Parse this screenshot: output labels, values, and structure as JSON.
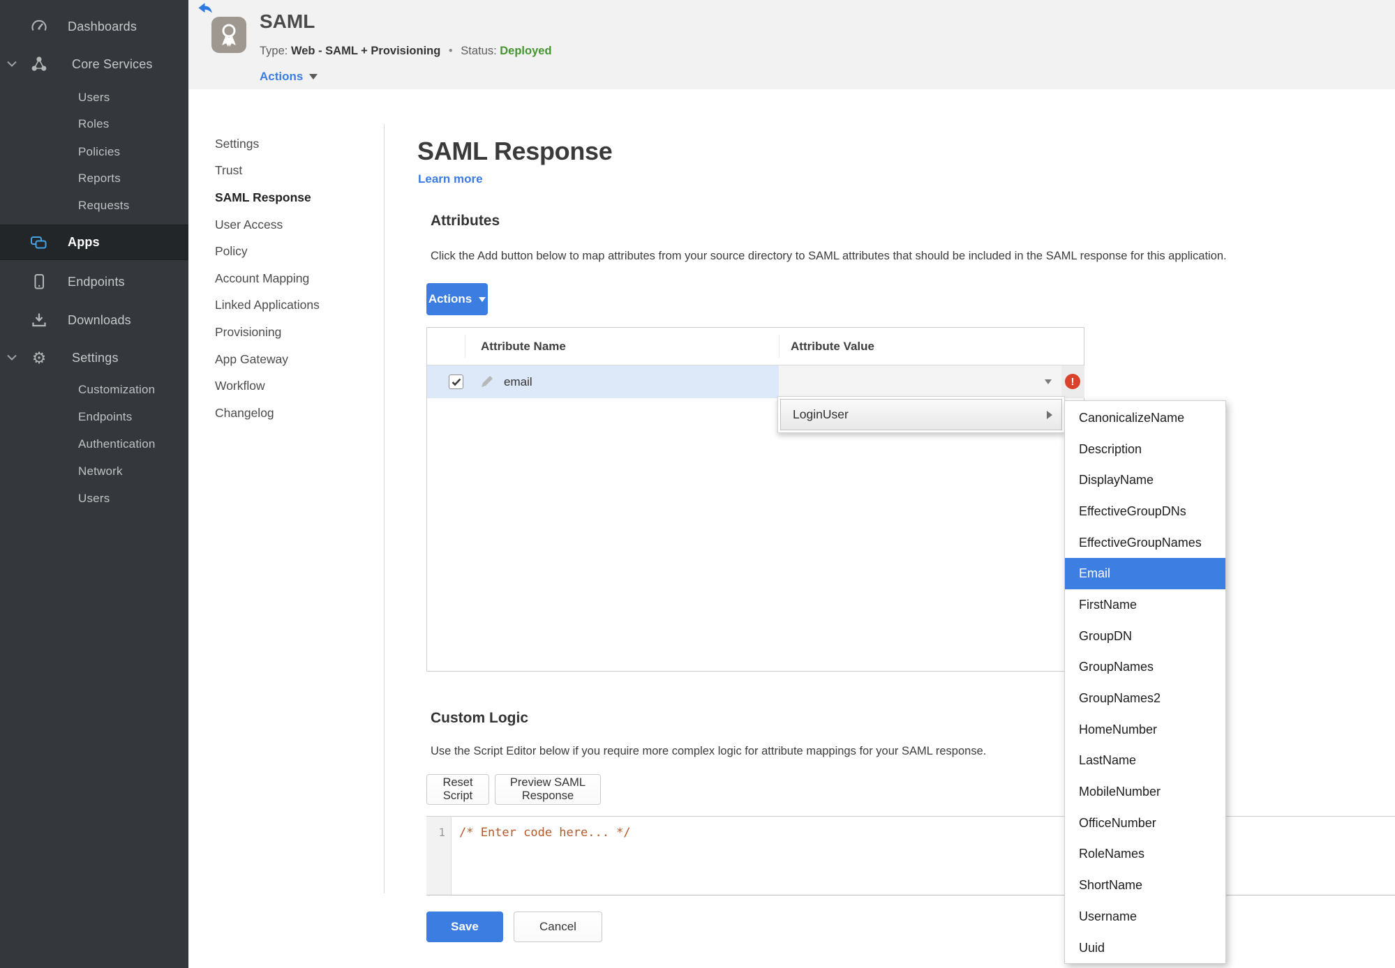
{
  "sidebar": {
    "items": [
      {
        "label": "Dashboards"
      },
      {
        "label": "Core Services"
      },
      {
        "label": "Users"
      },
      {
        "label": "Roles"
      },
      {
        "label": "Policies"
      },
      {
        "label": "Reports"
      },
      {
        "label": "Requests"
      },
      {
        "label": "Apps",
        "active": true
      },
      {
        "label": "Endpoints"
      },
      {
        "label": "Downloads"
      },
      {
        "label": "Settings"
      },
      {
        "label": "Customization"
      },
      {
        "label": "Endpoints"
      },
      {
        "label": "Authentication"
      },
      {
        "label": "Network"
      },
      {
        "label": "Users"
      }
    ]
  },
  "header": {
    "title": "SAML",
    "type_label": "Type:",
    "type_value": "Web - SAML + Provisioning",
    "separator": "•",
    "status_label": "Status:",
    "status_value": "Deployed",
    "actions_label": "Actions"
  },
  "subnav": {
    "items": [
      {
        "label": "Settings"
      },
      {
        "label": "Trust"
      },
      {
        "label": "SAML Response",
        "active": true
      },
      {
        "label": "User Access"
      },
      {
        "label": "Policy"
      },
      {
        "label": "Account Mapping"
      },
      {
        "label": "Linked Applications"
      },
      {
        "label": "Provisioning"
      },
      {
        "label": "App Gateway"
      },
      {
        "label": "Workflow"
      },
      {
        "label": "Changelog"
      }
    ]
  },
  "page": {
    "title": "SAML Response",
    "learn_more": "Learn more"
  },
  "attributes": {
    "heading": "Attributes",
    "description": "Click the Add button below to map attributes from your source directory to SAML attributes that should be included in the SAML response for this application.",
    "actions_label": "Actions",
    "columns": [
      "Attribute Name",
      "Attribute Value"
    ],
    "row": {
      "name": "email",
      "checked": true,
      "error": true
    }
  },
  "value_menu": {
    "parent_label": "LoginUser",
    "options": [
      "CanonicalizeName",
      "Description",
      "DisplayName",
      "EffectiveGroupDNs",
      "EffectiveGroupNames",
      "Email",
      "FirstName",
      "GroupDN",
      "GroupNames",
      "GroupNames2",
      "HomeNumber",
      "LastName",
      "MobileNumber",
      "OfficeNumber",
      "RoleNames",
      "ShortName",
      "Username",
      "Uuid"
    ],
    "selected": "Email"
  },
  "custom_logic": {
    "heading": "Custom Logic",
    "description": "Use the Script Editor below if you require more complex logic for attribute mappings for your SAML response.",
    "reset_label": "Reset Script",
    "preview_label": "Preview SAML Response",
    "line_number": "1",
    "code": "/* Enter code here... */"
  },
  "footer": {
    "save_label": "Save",
    "cancel_label": "Cancel"
  },
  "colors": {
    "accent_blue": "#3b7de0",
    "status_green": "#43962d",
    "error_red": "#d9432c",
    "selection_blue": "#3c7ee2",
    "row_highlight": "#dde9f8",
    "code_comment": "#b3592a",
    "sidebar_bg": "#34373b"
  }
}
